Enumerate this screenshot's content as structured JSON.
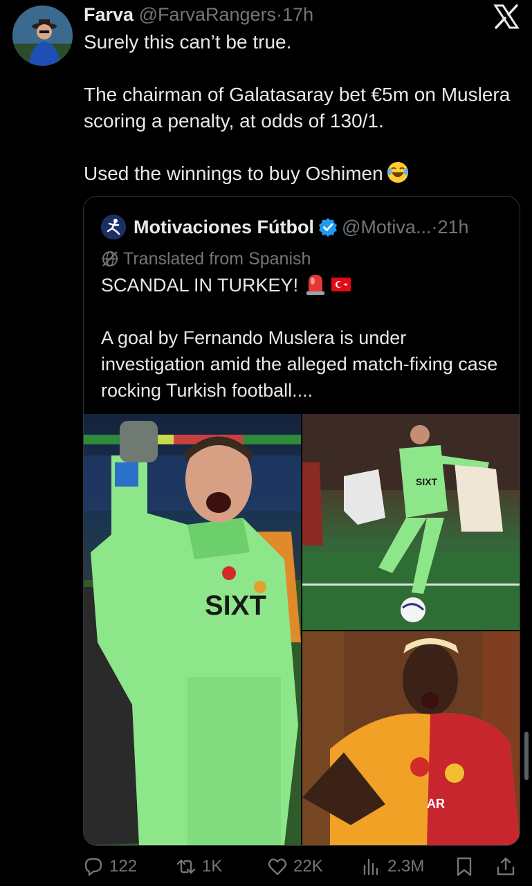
{
  "post": {
    "author_name": "Farva",
    "author_handle": "@FarvaRangers",
    "separator": "·",
    "time": "17h",
    "lines": [
      "Surely this can’t be true.",
      "The chairman of Galatasaray bet €5m on Muslera scoring a penalty, at odds of 130/1.",
      "Used the winnings to buy Oshimen"
    ]
  },
  "quote": {
    "author_name": "Motivaciones Fútbol",
    "author_handle": "@Motiva...",
    "separator": "·",
    "time": "21h",
    "translated_label": "Translated from Spanish",
    "headline": "SCANDAL IN TURKEY!",
    "body": "A goal by Fernando Muslera is under investigation amid the alleged match-fixing case rocking Turkish football....",
    "image_texts": {
      "sponsor_main": "SIXT",
      "sponsor_small": "SIXT",
      "shirt_text_partial": "AR"
    }
  },
  "actions": {
    "replies": "122",
    "reposts": "1K",
    "likes": "22K",
    "views": "2.3M"
  },
  "colors": {
    "background": "#000000",
    "text": "#e7e9ea",
    "muted": "#71767b",
    "border": "#2f3336",
    "verified": "#1d9bf0"
  },
  "icons": [
    "x-logo-icon",
    "verified-badge-icon",
    "globe-slash-icon",
    "siren-icon",
    "turkey-flag-icon",
    "laughing-emoji-icon",
    "reply-icon",
    "repost-icon",
    "like-icon",
    "views-icon",
    "bookmark-icon",
    "share-icon"
  ]
}
